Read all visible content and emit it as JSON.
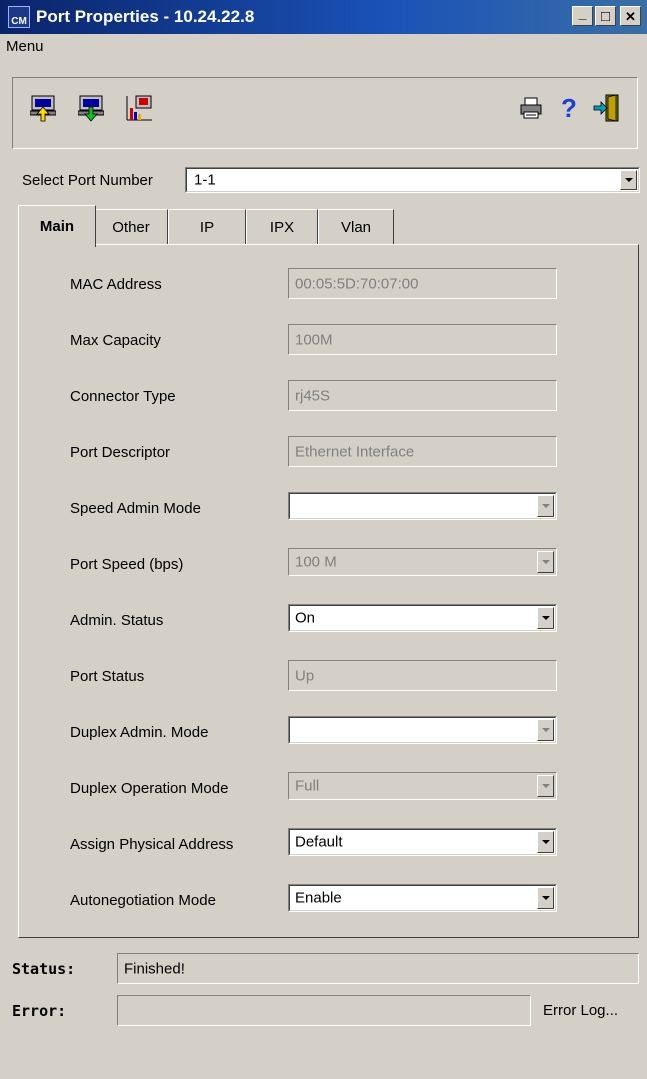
{
  "window": {
    "title": "Port Properties - 10.24.22.8",
    "app_icon_text": "CM",
    "minimize": "_",
    "maximize": "□",
    "close": "✕"
  },
  "menu": {
    "label": "Menu"
  },
  "toolbar": {
    "buttons": [
      "upload-icon",
      "download-icon",
      "statistics-chart-icon"
    ],
    "right_buttons": [
      "print-icon",
      "help-icon",
      "exit-icon"
    ],
    "help_glyph": "?"
  },
  "port_select": {
    "label": "Select Port Number",
    "value": "1-1"
  },
  "tabs": [
    {
      "label": "Main",
      "active": true
    },
    {
      "label": "Other",
      "active": false
    },
    {
      "label": "IP",
      "active": false
    },
    {
      "label": "IPX",
      "active": false
    },
    {
      "label": "Vlan",
      "active": false
    }
  ],
  "fields": {
    "mac_address": {
      "label": "MAC Address",
      "value": "00:05:5D:70:07:00"
    },
    "max_capacity": {
      "label": "Max Capacity",
      "value": "100M"
    },
    "connector_type": {
      "label": "Connector Type",
      "value": "rj45S"
    },
    "port_descriptor": {
      "label": "Port Descriptor",
      "value": "Ethernet Interface"
    },
    "speed_admin_mode": {
      "label": "Speed Admin Mode",
      "value": ""
    },
    "port_speed": {
      "label": "Port Speed (bps)",
      "value": "100 M"
    },
    "admin_status": {
      "label": "Admin. Status",
      "value": "On"
    },
    "port_status": {
      "label": "Port Status",
      "value": "Up"
    },
    "duplex_admin_mode": {
      "label": "Duplex Admin. Mode",
      "value": ""
    },
    "duplex_operation_mode": {
      "label": "Duplex Operation Mode",
      "value": "Full"
    },
    "assign_physical_address": {
      "label": "Assign Physical Address",
      "value": "Default"
    },
    "autonegotiation_mode": {
      "label": "Autonegotiation Mode",
      "value": "Enable"
    }
  },
  "status": {
    "label": "Status:",
    "value": "Finished!"
  },
  "error": {
    "label": "Error:",
    "value": "",
    "log_link": "Error Log..."
  },
  "colors": {
    "title_bar": "#0a246a",
    "face": "#d4d0c8",
    "help_blue": "#1a3fd8"
  }
}
